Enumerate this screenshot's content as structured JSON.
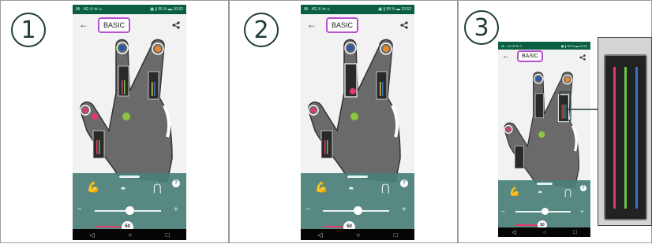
{
  "steps": [
    {
      "number": "1",
      "mode": "BASIC",
      "status_left": "Mi · 4G ✆ ✉ ⚠",
      "status_right": "▣ ∦ 95 % ▬ 10:52",
      "slider_value": "50"
    },
    {
      "number": "2",
      "mode": "BASIC",
      "status_left": "Mi · 4G ✆ ✉ ⚠",
      "status_right": "▣ ∦ 95 % ▬ 10:52",
      "slider_value": "50"
    },
    {
      "number": "3",
      "mode": "BASIC",
      "status_left": "Mi · 4G ✆ ✉ ⚠",
      "status_right": "▣ ∦ 95 % ▬ 10:52",
      "slider_value": "50"
    }
  ],
  "icons": {
    "back": "←",
    "share": "share-icon",
    "help": "?",
    "minus": "−",
    "plus": "+",
    "nav_back": "◁",
    "nav_home": "○",
    "nav_recent": "□"
  },
  "colors": {
    "blue": "#2c5aa0",
    "orange": "#e88a2a",
    "green": "#8cc63f",
    "pink": "#e23a6d",
    "panel": "#4a8078",
    "mode_border": "#b84fd0",
    "lead_pink": "#e23a6d",
    "lead_green": "#6fc24a",
    "lead_blue": "#3a74c4"
  }
}
